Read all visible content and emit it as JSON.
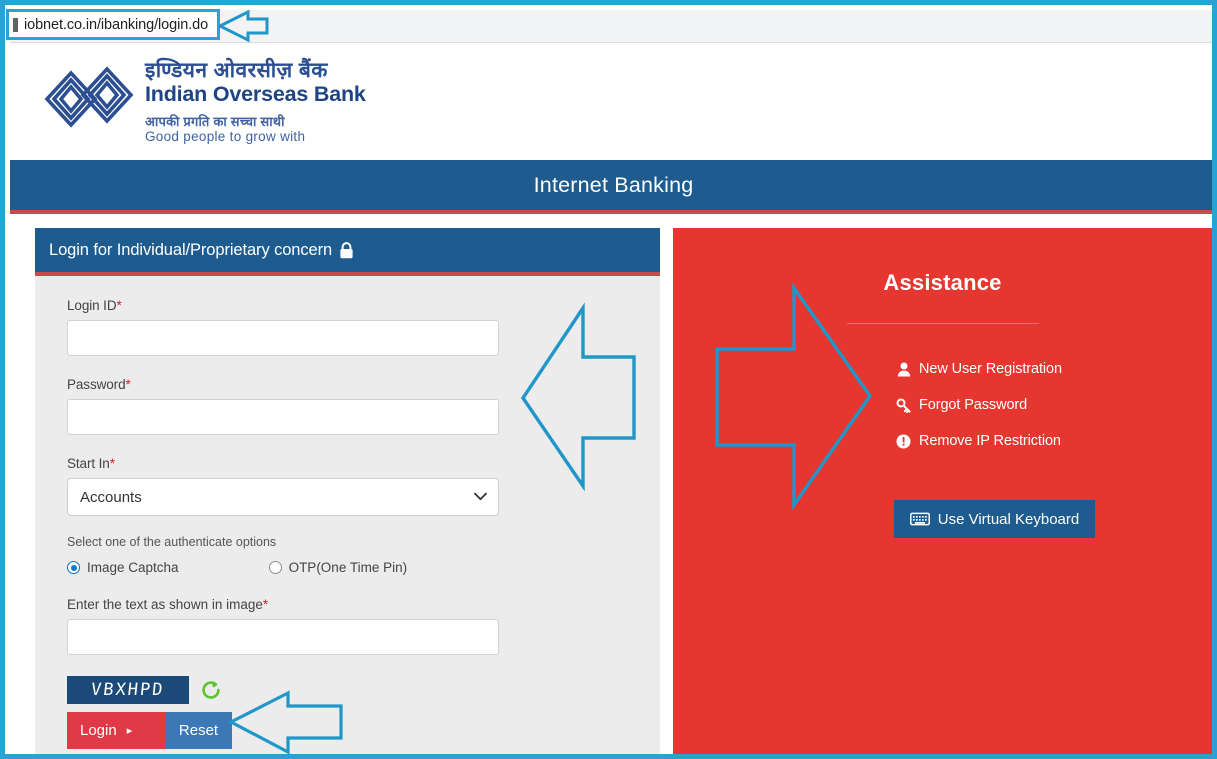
{
  "browser": {
    "url": "iobnet.co.in/ibanking/login.do"
  },
  "brand": {
    "hindi_name": "इण्डियन ओवरसीज़ बैंक",
    "english_name": "Indian Overseas Bank",
    "hindi_tagline": "आपकी प्रगति का सच्चा साथी",
    "english_tagline": "Good people to grow with",
    "logo_icon": "iob-double-diamond-logo",
    "logo_color": "#2c4f91"
  },
  "header": {
    "title": "Internet Banking",
    "bar_color": "#1e5b8e",
    "accent_color": "#c94a48"
  },
  "login_panel": {
    "title": "Login for Individual/Proprietary concern",
    "lock_icon": "lock-icon",
    "fields": {
      "login_id": {
        "label": "Login ID",
        "required_marker": "*",
        "value": "",
        "placeholder": ""
      },
      "password": {
        "label": "Password",
        "required_marker": "*",
        "value": "",
        "placeholder": ""
      },
      "start_in": {
        "label": "Start In",
        "required_marker": "*",
        "selected": "Accounts",
        "options": [
          "Accounts"
        ],
        "caret_icon": "chevron-down-icon"
      },
      "captcha_text": {
        "label": "Enter the text as shown in image",
        "required_marker": "*",
        "value": "",
        "placeholder": ""
      }
    },
    "auth_options": {
      "label": "Select one of the authenticate options",
      "options": [
        {
          "label": "Image Captcha",
          "selected": true
        },
        {
          "label": "OTP(One Time Pin)",
          "selected": false
        }
      ],
      "selected_color": "#1277d0"
    },
    "captcha": {
      "image_text": "VBXHPD",
      "background": "#1b4a78",
      "refresh_icon": "refresh-icon",
      "refresh_color": "#5ec42b"
    },
    "buttons": {
      "login": {
        "label": "Login",
        "caret": "▸",
        "color": "#e03a48"
      },
      "reset": {
        "label": "Reset",
        "color": "#3b78b5"
      }
    }
  },
  "assistance_panel": {
    "title": "Assistance",
    "background": "#e5362f",
    "links": [
      {
        "label": "New User Registration",
        "icon": "user-icon"
      },
      {
        "label": "Forgot Password",
        "icon": "key-icon"
      },
      {
        "label": "Remove IP Restriction",
        "icon": "info-circle-icon"
      }
    ],
    "virtual_keyboard_button": {
      "label": "Use Virtual Keyboard",
      "icon": "keyboard-icon",
      "color": "#1e5b8e"
    }
  },
  "annotations": {
    "color": "#2196c9",
    "arrows": [
      {
        "name": "arrow-to-url-bar",
        "direction": "left"
      },
      {
        "name": "arrow-to-login-form",
        "direction": "left"
      },
      {
        "name": "arrow-to-assistance",
        "direction": "right"
      },
      {
        "name": "arrow-to-login-buttons",
        "direction": "left"
      }
    ]
  }
}
